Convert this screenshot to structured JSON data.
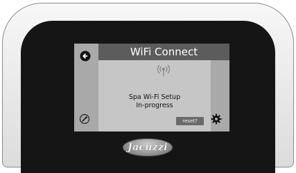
{
  "screen": {
    "title": "WiFi Connect",
    "message_line1": "Spa Wi-Fi Setup",
    "message_line2": "In-progress",
    "reset_label": "reset?"
  },
  "brand": {
    "logo_text": "Jacuzzi"
  },
  "icons": {
    "back": "back-arrow-icon",
    "status": "wifi-signal-icon",
    "settings": "gear-icon",
    "tools": "wand-icon"
  },
  "colors": {
    "bezel": "#151515",
    "screen_sidebar": "#a9a9a9",
    "header_bg": "#5c5c5c",
    "content_bg": "#c6c6c6",
    "reset_bg": "#6a6a6a"
  }
}
